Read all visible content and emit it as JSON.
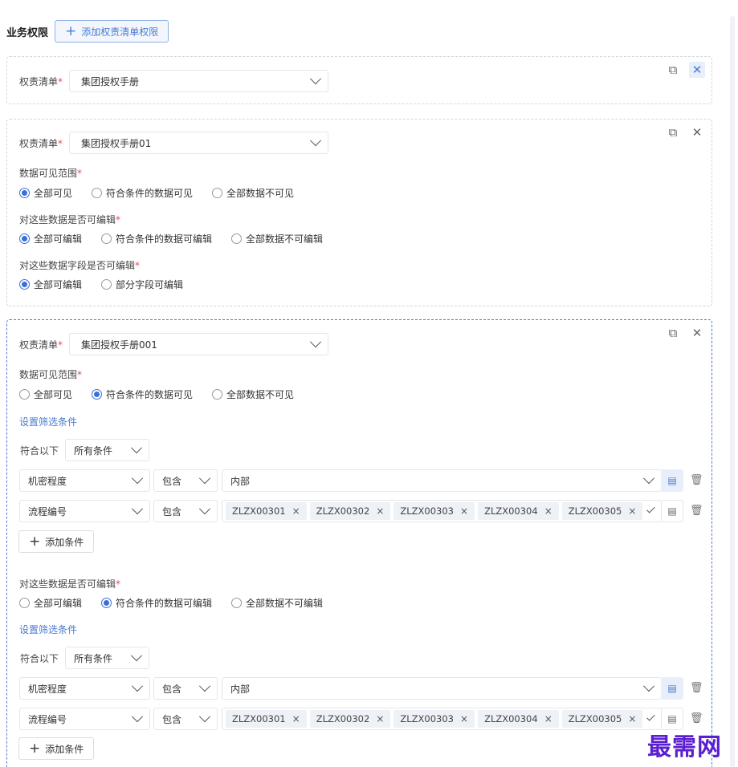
{
  "header": {
    "title": "业务权限",
    "add_btn": "添加权责清单权限"
  },
  "labels": {
    "list": "权责清单",
    "visible": "数据可见范围",
    "editable": "对这些数据是否可编辑",
    "field_editable": "对这些数据字段是否可编辑",
    "set_filter": "设置筛选条件",
    "match": "符合以下",
    "add_condition": "添加条件"
  },
  "cards": [
    {
      "list_value": "集团授权手册"
    },
    {
      "list_value": "集团授权手册01",
      "visible_opts": [
        "全部可见",
        "符合条件的数据可见",
        "全部数据不可见"
      ],
      "edit_opts": [
        "全部可编辑",
        "符合条件的数据可编辑",
        "全部数据不可编辑"
      ],
      "field_opts": [
        "全部可编辑",
        "部分字段可编辑"
      ]
    },
    {
      "list_value": "集团授权手册001",
      "visible_opts": [
        "全部可见",
        "符合条件的数据可见",
        "全部数据不可见"
      ],
      "edit_opts": [
        "全部可编辑",
        "符合条件的数据可编辑",
        "全部数据不可编辑"
      ],
      "match_value": "所有条件",
      "cond1": {
        "field": "机密程度",
        "op": "包含",
        "value": "内部"
      },
      "cond2": {
        "field": "流程编号",
        "op": "包含",
        "tags": [
          "ZLZX00301",
          "ZLZX00302",
          "ZLZX00303",
          "ZLZX00304",
          "ZLZX00305"
        ]
      }
    }
  ],
  "tag_close": "×",
  "watermark": "最需网"
}
